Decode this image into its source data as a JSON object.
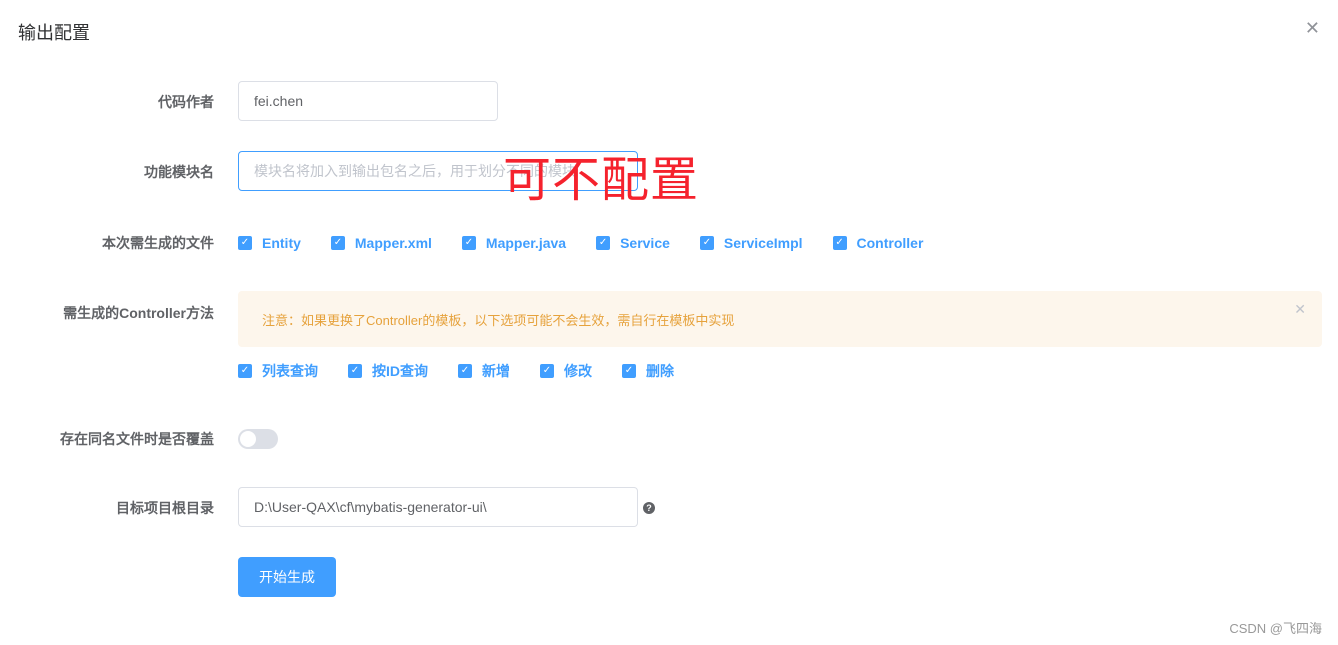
{
  "dialog": {
    "title": "输出配置",
    "close_icon": "close-icon"
  },
  "form": {
    "author": {
      "label": "代码作者",
      "value": "fei.chen"
    },
    "module": {
      "label": "功能模块名",
      "placeholder": "模块名将加入到输出包名之后，用于划分不同的模块"
    },
    "files": {
      "label": "本次需生成的文件",
      "options": [
        {
          "label": "Entity",
          "checked": true
        },
        {
          "label": "Mapper.xml",
          "checked": true
        },
        {
          "label": "Mapper.java",
          "checked": true
        },
        {
          "label": "Service",
          "checked": true
        },
        {
          "label": "ServiceImpl",
          "checked": true
        },
        {
          "label": "Controller",
          "checked": true
        }
      ]
    },
    "methods": {
      "label": "需生成的Controller方法",
      "alert": "注意：如果更换了Controller的模板，以下选项可能不会生效，需自行在模板中实现",
      "options": [
        {
          "label": "列表查询",
          "checked": true
        },
        {
          "label": "按ID查询",
          "checked": true
        },
        {
          "label": "新增",
          "checked": true
        },
        {
          "label": "修改",
          "checked": true
        },
        {
          "label": "删除",
          "checked": true
        }
      ]
    },
    "overwrite": {
      "label": "存在同名文件时是否覆盖",
      "on": false
    },
    "root": {
      "label": "目标项目根目录",
      "value": "D:\\User-QAX\\cf\\mybatis-generator-ui\\"
    },
    "submit": "开始生成"
  },
  "annotation": "可不配置",
  "watermark": "CSDN @飞四海",
  "colors": {
    "primary": "#409eff",
    "warning": "#e6a23c",
    "annotation": "#f5222d"
  }
}
